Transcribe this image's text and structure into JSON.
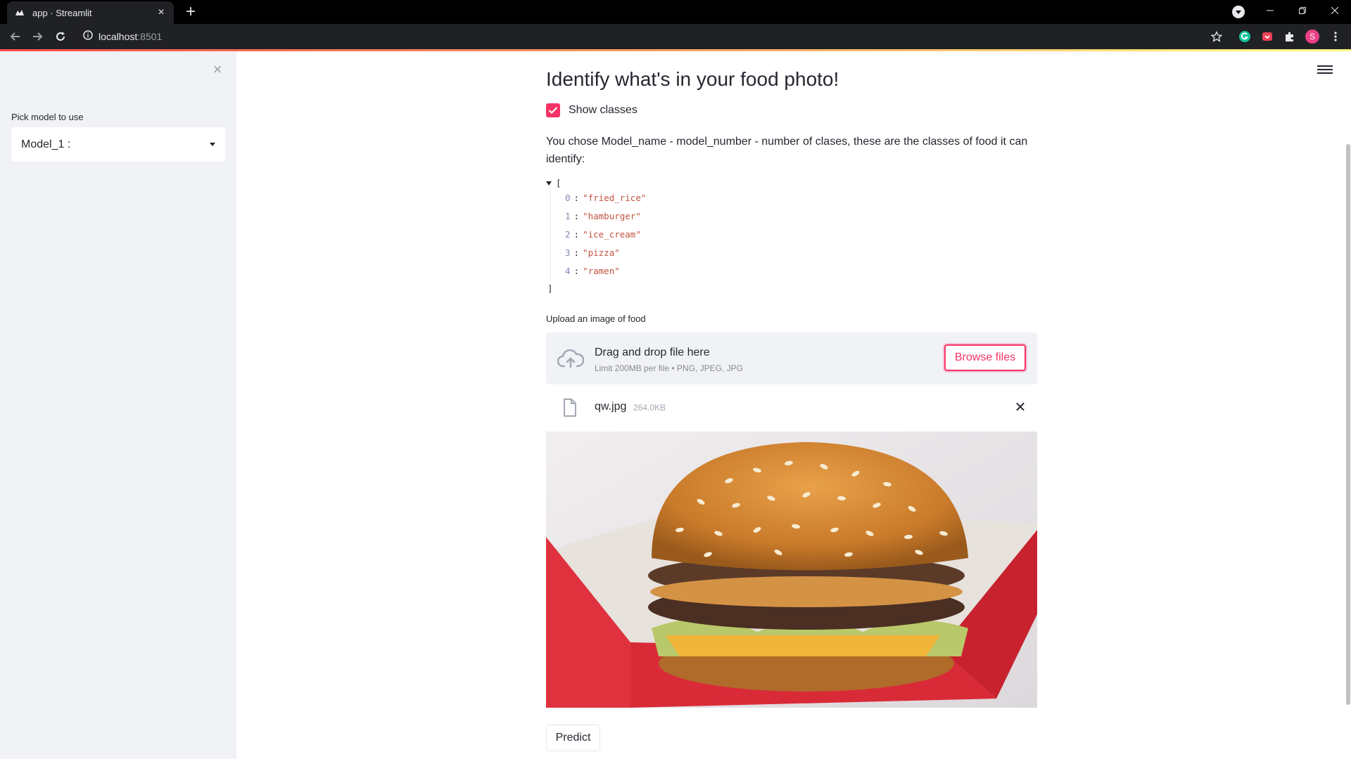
{
  "browser": {
    "tab_title": "app · Streamlit",
    "url_host": "localhost",
    "url_port": ":8501",
    "profile_initial": "S"
  },
  "sidebar": {
    "select_label": "Pick model to use",
    "select_value": "Model_1 :"
  },
  "main": {
    "title": "Identify what's in your food photo!",
    "show_classes_label": "Show classes",
    "show_classes_checked": true,
    "description": "You chose Model_name - model_number - number of clases, these are the classes of food it can identify:",
    "json_open": "[",
    "json_close": "]",
    "classes": [
      {
        "index": "0",
        "value": "\"fried_rice\""
      },
      {
        "index": "1",
        "value": "\"hamburger\""
      },
      {
        "index": "2",
        "value": "\"ice_cream\""
      },
      {
        "index": "3",
        "value": "\"pizza\""
      },
      {
        "index": "4",
        "value": "\"ramen\""
      }
    ],
    "upload_label": "Upload an image of food",
    "dropzone_title": "Drag and drop file here",
    "dropzone_limits": "Limit 200MB per file • PNG, JPEG, JPG",
    "browse_label": "Browse files",
    "file_name": "qw.jpg",
    "file_size": "264.0KB",
    "predict_label": "Predict"
  },
  "colors": {
    "primary": "#f63366",
    "sidebar_bg": "#f0f2f6",
    "text": "#262730"
  }
}
